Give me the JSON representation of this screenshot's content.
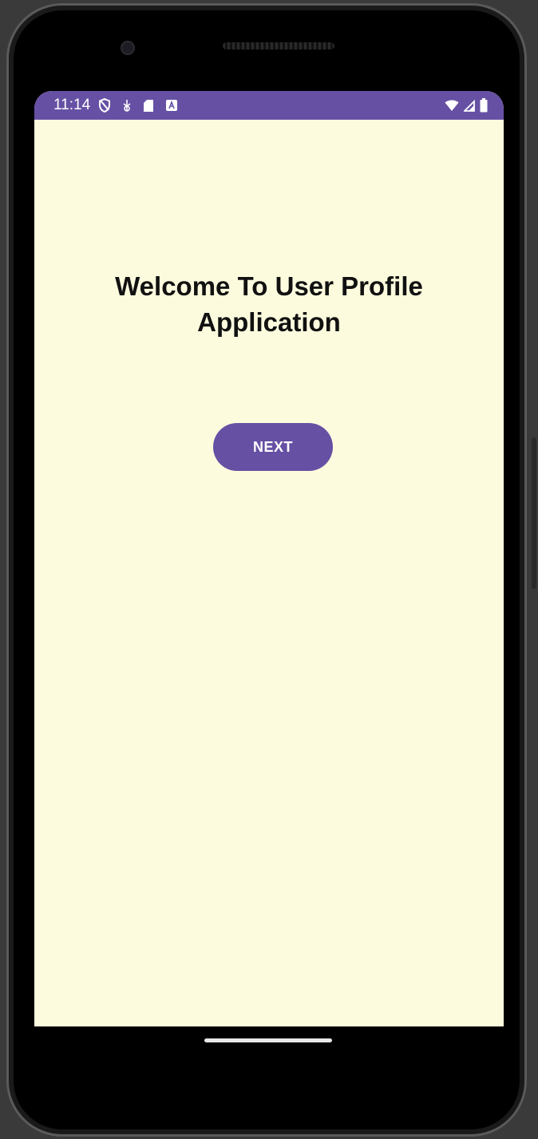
{
  "status_bar": {
    "time": "11:14",
    "icons_left": [
      "privacy-shield-icon",
      "usb-debug-icon",
      "sd-card-icon",
      "app-notification-icon"
    ],
    "icons_right": [
      "wifi-icon",
      "cellular-signal-icon",
      "battery-icon"
    ],
    "color": "#6650a4"
  },
  "main": {
    "title_line1": "Welcome To User Profile",
    "title_line2": "Application",
    "next_label": "NEXT",
    "background_color": "#fdfbde",
    "accent_color": "#6650a4"
  }
}
